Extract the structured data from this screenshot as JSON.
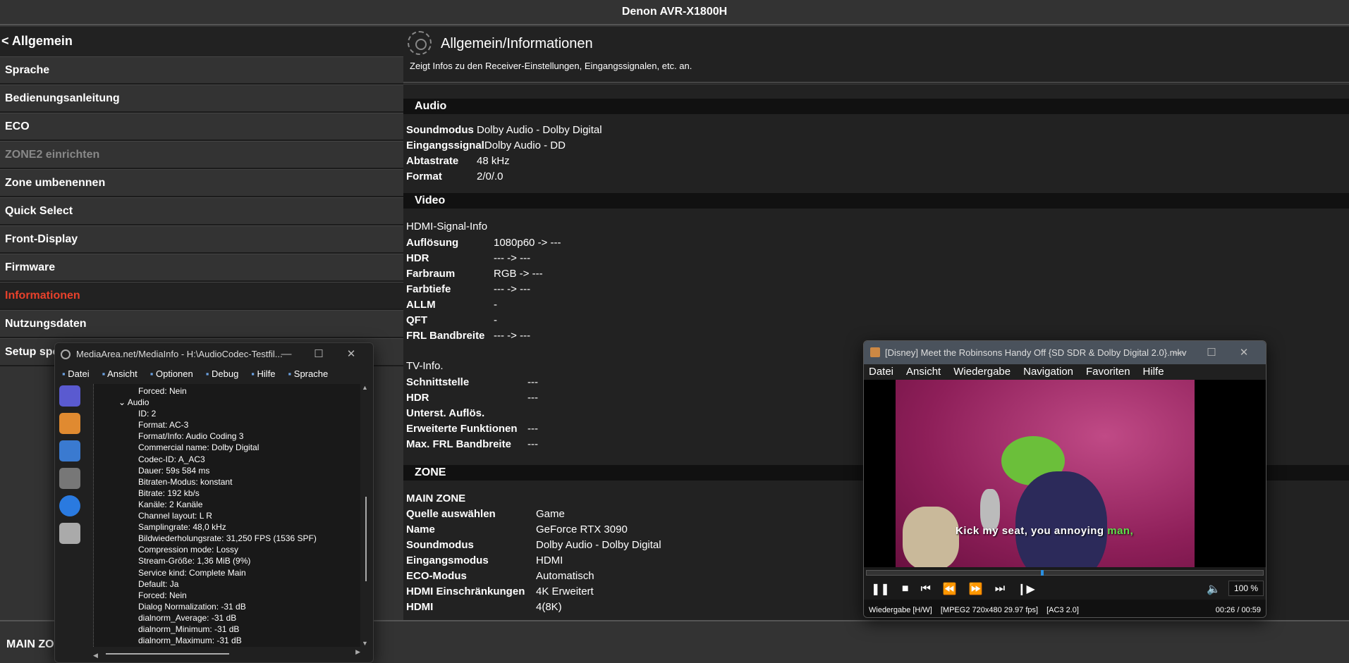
{
  "app_title": "Denon AVR-X1800H",
  "sidebar": {
    "back_label": "< Allgemein",
    "items": [
      {
        "label": "Sprache",
        "state": "normal"
      },
      {
        "label": "Bedienungsanleitung",
        "state": "normal"
      },
      {
        "label": "ECO",
        "state": "normal"
      },
      {
        "label": "ZONE2 einrichten",
        "state": "disabled"
      },
      {
        "label": "Zone umbenennen",
        "state": "normal"
      },
      {
        "label": "Quick Select",
        "state": "normal"
      },
      {
        "label": "Front-Display",
        "state": "normal"
      },
      {
        "label": "Firmware",
        "state": "normal"
      },
      {
        "label": "Informationen",
        "state": "active"
      },
      {
        "label": "Nutzungsdaten",
        "state": "normal"
      },
      {
        "label": "Setup spe",
        "state": "normal"
      }
    ]
  },
  "main": {
    "title": "Allgemein/Informationen",
    "subtitle": "Zeigt Infos zu den Receiver-Einstellungen, Eingangssignalen, etc. an.",
    "audio": {
      "header": "Audio",
      "rows": [
        [
          "Soundmodus",
          "Dolby Audio - Dolby Digital"
        ],
        [
          "Eingangssignal",
          "Dolby Audio - DD"
        ],
        [
          "Abtastrate",
          "48 kHz"
        ],
        [
          "Format",
          "2/0/.0"
        ]
      ]
    },
    "video": {
      "header": "Video",
      "hdmi_title": "HDMI-Signal-Info",
      "hdmi_rows": [
        [
          "Auflösung",
          "1080p60 -> ---"
        ],
        [
          "HDR",
          "--- -> ---"
        ],
        [
          "Farbraum",
          "RGB -> ---"
        ],
        [
          "Farbtiefe",
          "--- -> ---"
        ],
        [
          "ALLM",
          "-"
        ],
        [
          "QFT",
          "-"
        ],
        [
          "FRL Bandbreite",
          "--- -> ---"
        ]
      ],
      "tv_title": "TV-Info.",
      "tv_rows": [
        [
          "Schnittstelle",
          "---"
        ],
        [
          "HDR",
          "---"
        ],
        [
          "Unterst. Auflös.",
          ""
        ],
        [
          "Erweiterte Funktionen",
          "---"
        ],
        [
          "Max. FRL Bandbreite",
          "---"
        ]
      ]
    },
    "zone": {
      "header": "ZONE",
      "title": "MAIN ZONE",
      "rows": [
        [
          "Quelle auswählen",
          "Game"
        ],
        [
          "Name",
          "GeForce RTX 3090"
        ],
        [
          "Soundmodus",
          "Dolby Audio - Dolby Digital"
        ],
        [
          "Eingangsmodus",
          "HDMI"
        ],
        [
          "ECO-Modus",
          "Automatisch"
        ],
        [
          "HDMI Einschränkungen",
          "4K Erweitert"
        ],
        [
          "HDMI",
          "4(8K)"
        ]
      ]
    }
  },
  "bottom_label": "MAIN ZONE",
  "mediainfo": {
    "title": "MediaArea.net/MediaInfo - H:\\AudioCodec-Testfil...",
    "menu": [
      "Datei",
      "Ansicht",
      "Optionen",
      "Debug",
      "Hilfe",
      "Sprache"
    ],
    "tree_top": "Forced: Nein",
    "node": "Audio",
    "lines": [
      "ID: 2",
      "Format: AC-3",
      "Format/Info: Audio Coding 3",
      "Commercial name: Dolby Digital",
      "Codec-ID: A_AC3",
      "Dauer: 59s 584 ms",
      "Bitraten-Modus: konstant",
      "Bitrate: 192 kb/s",
      "Kanäle: 2 Kanäle",
      "Channel layout: L R",
      "Samplingrate: 48,0 kHz",
      "Bildwiederholungsrate: 31,250 FPS (1536 SPF)",
      "Compression mode: Lossy",
      "Stream-Größe: 1,36 MiB (9%)",
      "Service kind: Complete Main",
      "Default: Ja",
      "Forced: Nein",
      "Dialog Normalization: -31 dB",
      "dialnorm_Average: -31 dB",
      "dialnorm_Minimum: -31 dB",
      "dialnorm_Maximum: -31 dB"
    ]
  },
  "player": {
    "title": "[Disney] Meet the Robinsons Handy Off {SD SDR & Dolby Digital 2.0}.mkv",
    "menu": [
      "Datei",
      "Ansicht",
      "Wiedergabe",
      "Navigation",
      "Favoriten",
      "Hilfe"
    ],
    "subtitle_text": "Kick my seat, you annoying ",
    "subtitle_highlight": "man,",
    "progress": 0.44,
    "volume": "100 %",
    "status": [
      "Wiedergabe [H/W]",
      "[MPEG2 720x480 29.97 fps]",
      "[AC3 2.0]"
    ],
    "time": "00:26 / 00:59"
  },
  "colors": {
    "accent": "#e8412b",
    "seek": "#2a8fe0"
  }
}
